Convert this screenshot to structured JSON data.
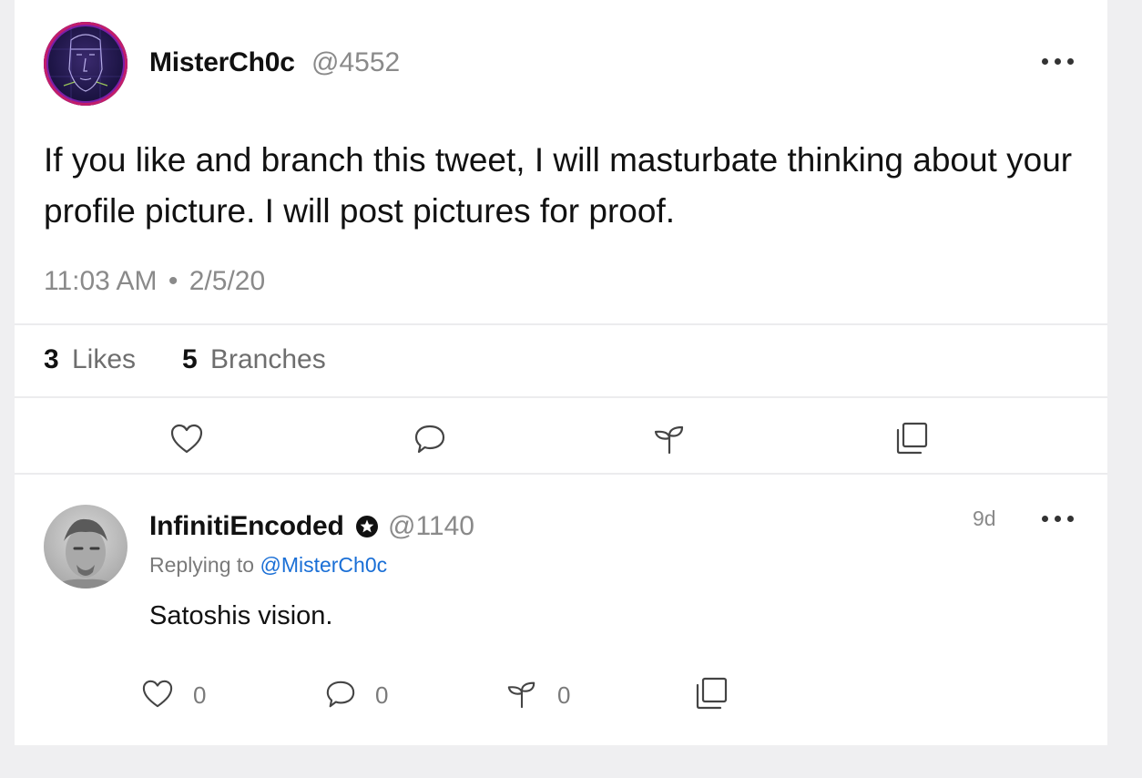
{
  "post": {
    "username": "MisterCh0c",
    "handle": "@4552",
    "text": "If you like and branch this tweet, I will masturbate thinking about your profile picture. I will post pictures for proof.",
    "time": "11:03 AM",
    "separator": "•",
    "date": "2/5/20",
    "stats": {
      "likes_count": "3",
      "likes_label": "Likes",
      "branches_count": "5",
      "branches_label": "Branches"
    },
    "actions": [
      "heart-icon",
      "comment-icon",
      "branch-icon",
      "copy-icon"
    ]
  },
  "reply": {
    "username": "InfinitiEncoded",
    "handle": "@1140",
    "age": "9d",
    "replying_prefix": "Replying to",
    "replying_to": "@MisterCh0c",
    "text": "Satoshis vision.",
    "counts": {
      "likes": "0",
      "comments": "0",
      "branches": "0"
    }
  },
  "colors": {
    "link": "#1a6fd6",
    "muted": "#8a8a8a",
    "background": "#efeff1",
    "card": "#ffffff"
  }
}
